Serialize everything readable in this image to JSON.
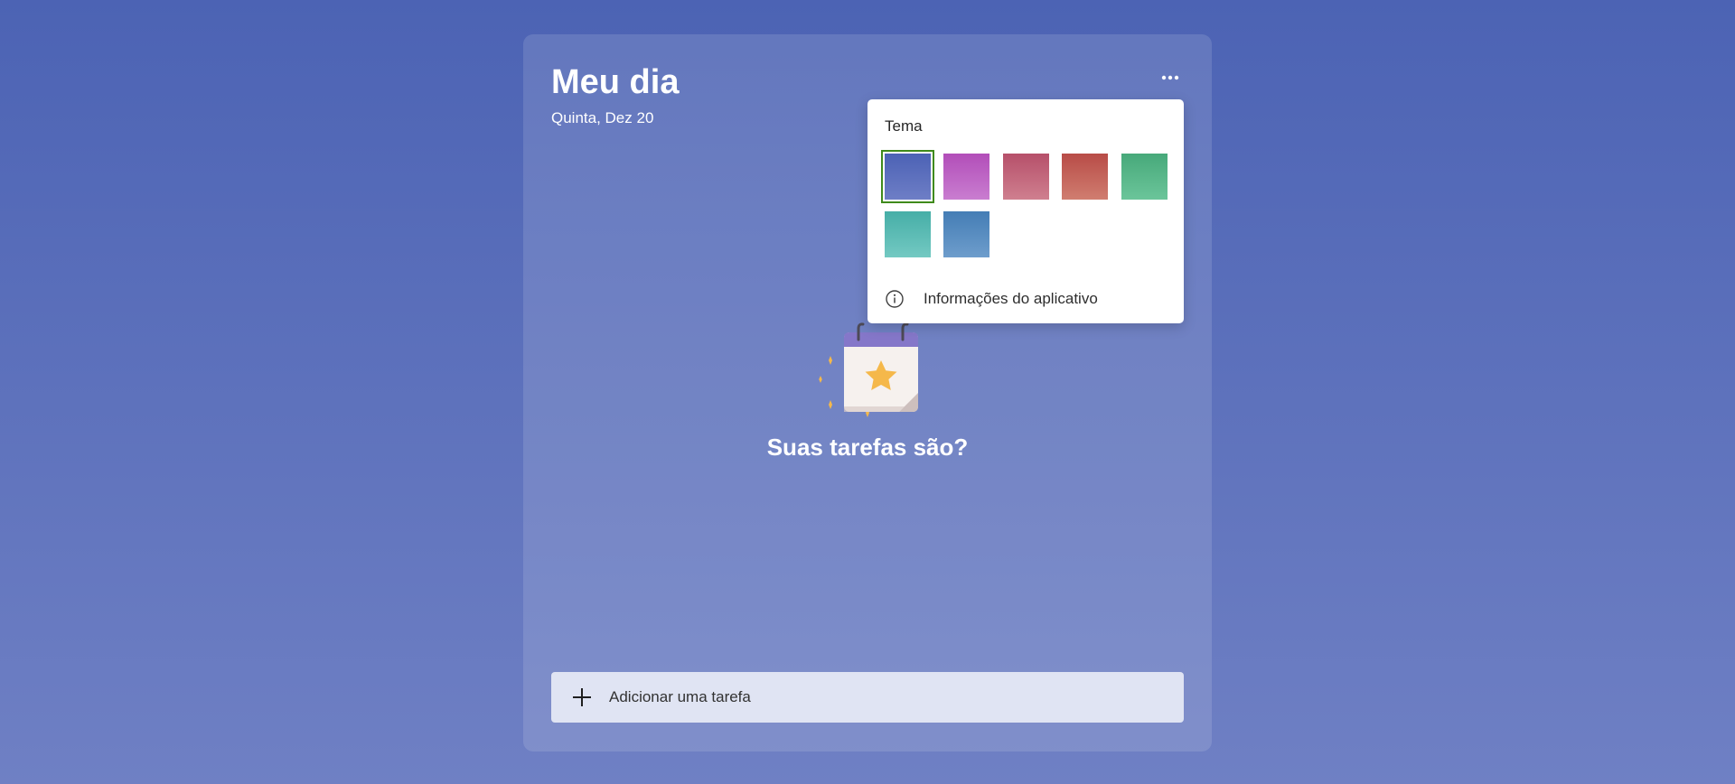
{
  "header": {
    "title": "Meu dia",
    "date": "Quinta, Dez 20"
  },
  "icons": {
    "more": "more-horizontal-icon",
    "add": "plus-icon",
    "info": "info-icon",
    "illustration": "calendar-star-illustration"
  },
  "empty_state": {
    "text": "Suas tarefas são?"
  },
  "add_task": {
    "placeholder": "Adicionar uma tarefa"
  },
  "theme_menu": {
    "title": "Tema",
    "selected_index": 0,
    "themes": [
      {
        "color_top": "#4c62b5",
        "color_bottom": "#6e7ec6"
      },
      {
        "color_top": "#b24eb9",
        "color_bottom": "#c97dd0"
      },
      {
        "color_top": "#b6506a",
        "color_bottom": "#cf7f8f"
      },
      {
        "color_top": "#b84c47",
        "color_bottom": "#d07d70"
      },
      {
        "color_top": "#47a97a",
        "color_bottom": "#6bc59a"
      },
      {
        "color_top": "#46aea7",
        "color_bottom": "#73c9c2"
      },
      {
        "color_top": "#447db5",
        "color_bottom": "#6e9dcc"
      }
    ],
    "info_label": "Informações do aplicativo"
  },
  "colors": {
    "background_top": "#4c63b4",
    "background_bottom": "#6f80c4",
    "selected_outline": "#3f8a1b",
    "star": "#f5b84a"
  }
}
